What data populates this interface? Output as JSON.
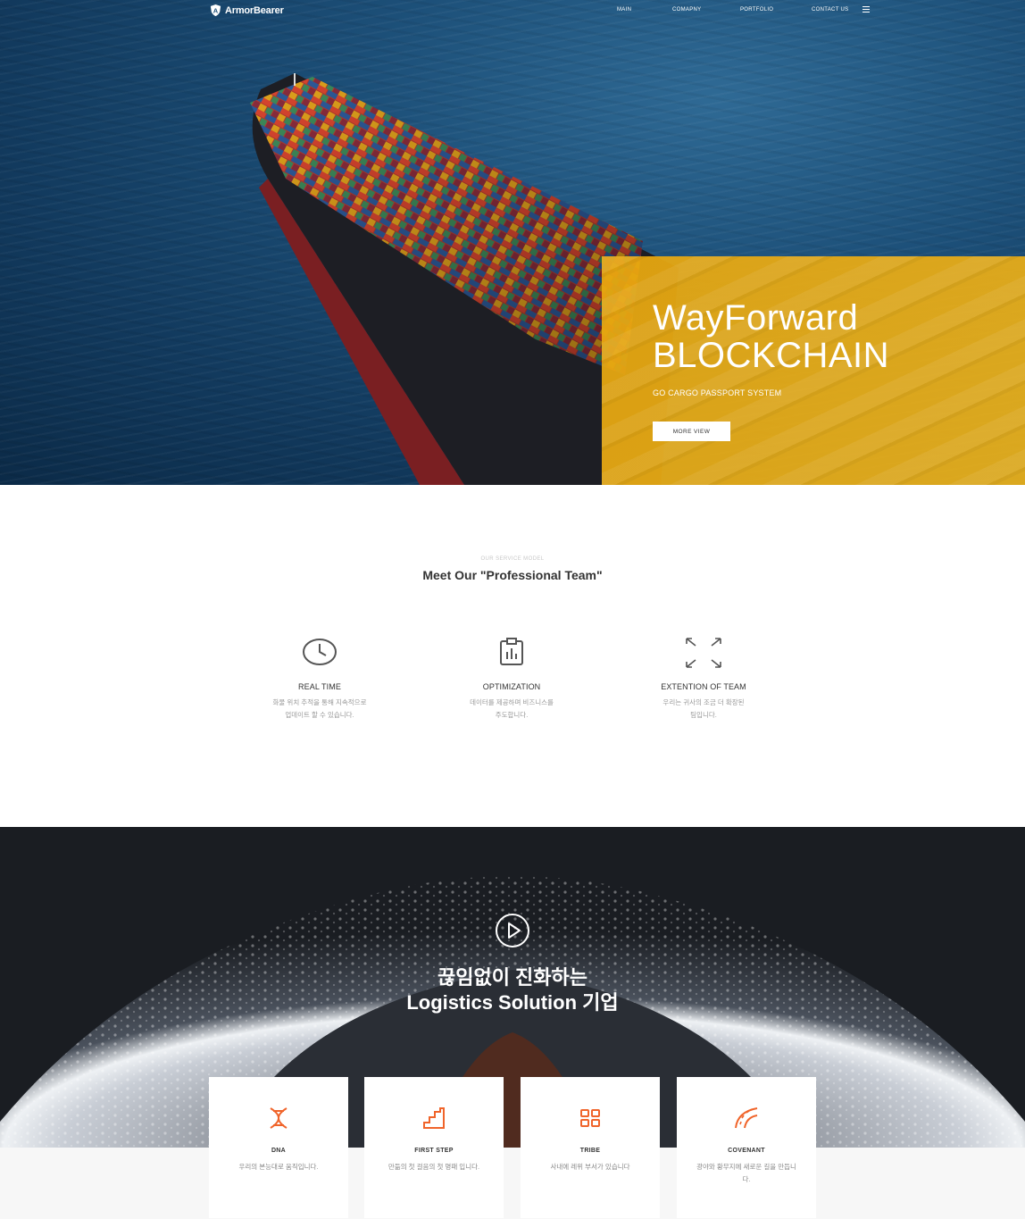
{
  "header": {
    "logo_text": "ArmorBearer",
    "nav": [
      "MAIN",
      "COMAPNY",
      "PORTFOLIO",
      "CONTACT US"
    ],
    "menu_icon": "hamburger-icon"
  },
  "hero": {
    "title_line1": "WayForward",
    "title_line2": "BLOCKCHAIN",
    "subtitle": "GO CARGO PASSPORT SYSTEM",
    "button_label": "MORE VIEW",
    "accent_color": "#eba915"
  },
  "service": {
    "eyebrow": "OUR SERVICE MODEL",
    "title": "Meet Our \"Professional Team\"",
    "features": [
      {
        "icon": "clock-icon",
        "name": "REAL TIME",
        "desc_line1": "화물 위치 추적을 통해 지속적으로",
        "desc_line2": "업데이트 할 수 있습니다."
      },
      {
        "icon": "clipboard-chart-icon",
        "name": "OPTIMIZATION",
        "desc_line1": "데이터를 제공하며 비즈니스를",
        "desc_line2": "주도합니다."
      },
      {
        "icon": "expand-arrows-icon",
        "name": "EXTENTION OF TEAM",
        "desc_line1": "우리는 귀사의 조금 더 확장된",
        "desc_line2": "팀입니다."
      }
    ]
  },
  "video_section": {
    "play_icon": "play-circle-icon",
    "title_line1": "끊임없이 진화하는",
    "title_line2": "Logistics Solution 기업"
  },
  "cards": [
    {
      "icon": "dna-icon",
      "name": "DNA",
      "desc": "우리의 본능대로 움직입니다."
    },
    {
      "icon": "stairs-icon",
      "name": "FIRST STEP",
      "desc": "만듦의 첫 걸음의 첫 명패 입니다."
    },
    {
      "icon": "grid-squares-icon",
      "name": "TRIBE",
      "desc": "사내에 레위 부서가 있습니다"
    },
    {
      "icon": "road-curve-icon",
      "name": "COVENANT",
      "desc": "광야와 황무지에 새로운 길을 만듭니다."
    }
  ],
  "colors": {
    "orange_icon": "#f0642a",
    "dark_bg": "#1a1d22"
  }
}
